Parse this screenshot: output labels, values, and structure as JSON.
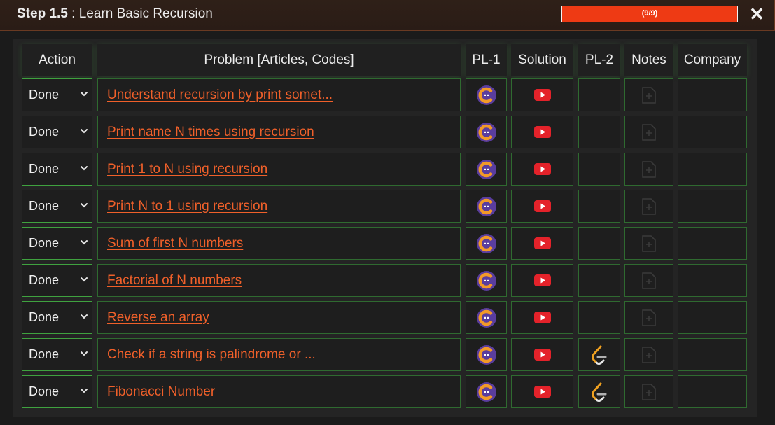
{
  "header": {
    "step_label": "Step 1.5",
    "separator": " : ",
    "title": "Learn Basic Recursion",
    "progress_text": "(9/9)",
    "progress_fraction": 1.0,
    "close_label": "✕"
  },
  "columns": [
    "Action",
    "Problem [Articles, Codes]",
    "PL-1",
    "Solution",
    "PL-2",
    "Notes",
    "Company"
  ],
  "rows": [
    {
      "action": "Done",
      "problem": "Understand recursion by print somet...",
      "pl1": "codingninjas-icon",
      "solution": "youtube-icon",
      "pl2": "",
      "notes": "add-note-icon"
    },
    {
      "action": "Done",
      "problem": "Print name N times using recursion",
      "pl1": "codingninjas-icon",
      "solution": "youtube-icon",
      "pl2": "",
      "notes": "add-note-icon"
    },
    {
      "action": "Done",
      "problem": "Print 1 to N using recursion",
      "pl1": "codingninjas-icon",
      "solution": "youtube-icon",
      "pl2": "",
      "notes": "add-note-icon"
    },
    {
      "action": "Done",
      "problem": "Print N to 1 using recursion",
      "pl1": "codingninjas-icon",
      "solution": "youtube-icon",
      "pl2": "",
      "notes": "add-note-icon"
    },
    {
      "action": "Done",
      "problem": "Sum of first N numbers",
      "pl1": "codingninjas-icon",
      "solution": "youtube-icon",
      "pl2": "",
      "notes": "add-note-icon"
    },
    {
      "action": "Done",
      "problem": "Factorial of N numbers",
      "pl1": "codingninjas-icon",
      "solution": "youtube-icon",
      "pl2": "",
      "notes": "add-note-icon"
    },
    {
      "action": "Done",
      "problem": "Reverse an array",
      "pl1": "codingninjas-icon",
      "solution": "youtube-icon",
      "pl2": "",
      "notes": "add-note-icon"
    },
    {
      "action": "Done",
      "problem": "Check if a string is palindrome or ...",
      "pl1": "codingninjas-icon",
      "solution": "youtube-icon",
      "pl2": "leetcode-icon",
      "notes": "add-note-icon"
    },
    {
      "action": "Done",
      "problem": "Fibonacci Number",
      "pl1": "codingninjas-icon",
      "solution": "youtube-icon",
      "pl2": "leetcode-icon",
      "notes": "add-note-icon"
    }
  ],
  "colors": {
    "accent": "#ee3a14",
    "link": "#f0602a",
    "cell_border": "#2f6a30",
    "youtube": "#e4222a",
    "codingninjas": "#5a3d9e"
  }
}
